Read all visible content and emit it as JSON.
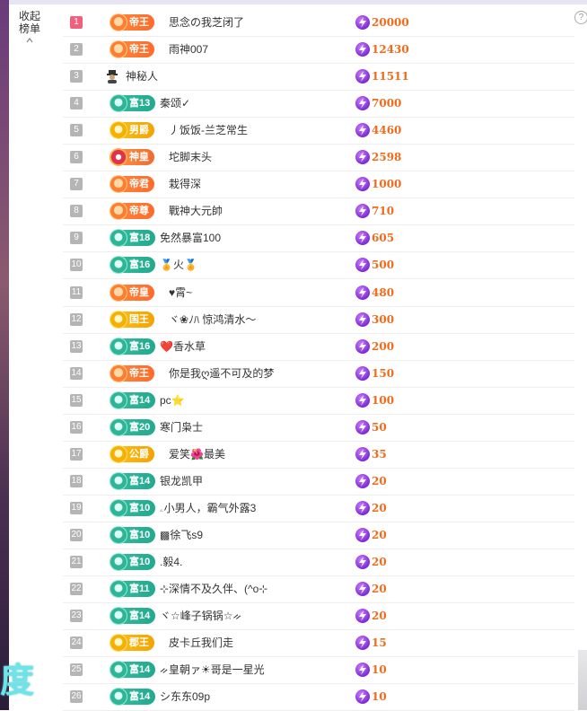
{
  "panel": {
    "collapse_line1": "收起",
    "collapse_line2": "榜单",
    "collapse_icon": "chevron-up-icon",
    "help_icon": "question-icon",
    "help_glyph": "?"
  },
  "background": {
    "bottom_left_text": "度"
  },
  "colors": {
    "rank_top": "#f0607c",
    "rank_default": "#b5b5b5",
    "amount": "#f06a1a",
    "coin": "#7a2bd6"
  },
  "ranking": [
    {
      "rank": "1",
      "badge": "帝王",
      "badge_style": "orange",
      "name": "思念の我芝闭了",
      "amount": "20000"
    },
    {
      "rank": "2",
      "badge": "帝王",
      "badge_style": "orange",
      "name": "雨神007",
      "amount": "12430"
    },
    {
      "rank": "3",
      "badge": "",
      "badge_style": "none",
      "name": "神秘人",
      "amount": "11511"
    },
    {
      "rank": "4",
      "badge": "富13",
      "badge_style": "teal",
      "name": "秦颂✓",
      "amount": "7000"
    },
    {
      "rank": "5",
      "badge": "男爵",
      "badge_style": "gold",
      "name": "丿饭饭-兰芝常生",
      "amount": "4460"
    },
    {
      "rank": "6",
      "badge": "神皇",
      "badge_style": "shen",
      "name": "坨脚末头",
      "amount": "2598"
    },
    {
      "rank": "7",
      "badge": "帝君",
      "badge_style": "orange",
      "name": "栽得深",
      "amount": "1000"
    },
    {
      "rank": "8",
      "badge": "帝尊",
      "badge_style": "orange",
      "name": "戰神大元帥",
      "amount": "710"
    },
    {
      "rank": "9",
      "badge": "富18",
      "badge_style": "teal",
      "name": "免然暴富100",
      "amount": "605"
    },
    {
      "rank": "10",
      "badge": "富16",
      "badge_style": "teal",
      "name": "🏅火🏅",
      "amount": "500"
    },
    {
      "rank": "11",
      "badge": "帝皇",
      "badge_style": "orange",
      "name": "♥霄~",
      "amount": "480"
    },
    {
      "rank": "12",
      "badge": "国王",
      "badge_style": "gold",
      "name": "ヾ❀ﾉﾊ 惊鸿清水～",
      "amount": "300"
    },
    {
      "rank": "13",
      "badge": "富16",
      "badge_style": "teal",
      "name": "❤️香水草",
      "amount": "200"
    },
    {
      "rank": "14",
      "badge": "帝王",
      "badge_style": "orange",
      "name": "你是我ღ遥不可及的梦",
      "amount": "150"
    },
    {
      "rank": "15",
      "badge": "富14",
      "badge_style": "teal",
      "name": "pc⭐",
      "amount": "100"
    },
    {
      "rank": "16",
      "badge": "富20",
      "badge_style": "teal",
      "name": "寒门枭士",
      "amount": "50"
    },
    {
      "rank": "17",
      "badge": "公爵",
      "badge_style": "gold",
      "name": "爱笑🌺最美",
      "amount": "35"
    },
    {
      "rank": "18",
      "badge": "富14",
      "badge_style": "teal",
      "name": "银龙凯甲",
      "amount": "20"
    },
    {
      "rank": "19",
      "badge": "富10",
      "badge_style": "teal",
      "name": "ۦ小男人，霸气外露3",
      "amount": "20"
    },
    {
      "rank": "20",
      "badge": "富10",
      "badge_style": "teal",
      "name": "▩徐飞s9",
      "amount": "20"
    },
    {
      "rank": "21",
      "badge": "富10",
      "badge_style": "teal",
      "name": ".毅4.",
      "amount": "20"
    },
    {
      "rank": "22",
      "badge": "富11",
      "badge_style": "teal",
      "name": "⊹深情不及久伴、(^o⊹",
      "amount": "20"
    },
    {
      "rank": "23",
      "badge": "富14",
      "badge_style": "teal",
      "name": "ヾ☆峰子锅锅☆ᨀ",
      "amount": "20"
    },
    {
      "rank": "24",
      "badge": "郡王",
      "badge_style": "gold",
      "name": "皮卡丘我们走",
      "amount": "15"
    },
    {
      "rank": "25",
      "badge": "富14",
      "badge_style": "teal",
      "name": "ᨀ皇朝ァ☀哥是一星光",
      "amount": "10"
    },
    {
      "rank": "26",
      "badge": "富14",
      "badge_style": "teal",
      "name": "シ东东09p",
      "amount": "10"
    }
  ]
}
